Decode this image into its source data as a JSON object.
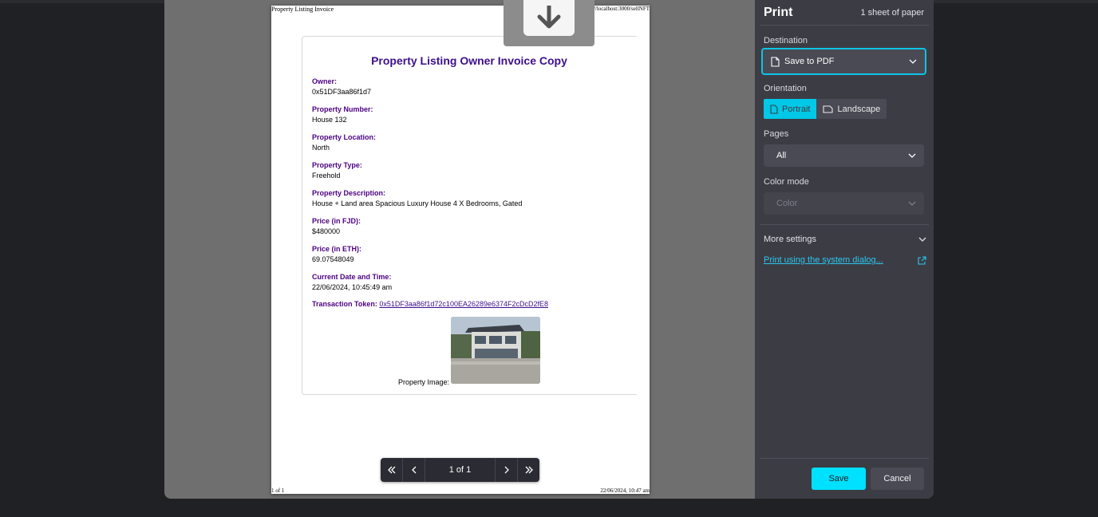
{
  "document": {
    "header_left": "Property Listing Invoice",
    "header_right": "http://localhost:3000/sellNFT",
    "footer_left": "1 of 1",
    "footer_right": "22/06/2024, 10:47 am",
    "title": "Property Listing Owner Invoice Copy",
    "fields": [
      {
        "label": "Owner:",
        "value": "0x51DF3aa86f1d7"
      },
      {
        "label": "Property Number:",
        "value": "House 132"
      },
      {
        "label": "Property Location:",
        "value": "North"
      },
      {
        "label": "Property Type:",
        "value": "Freehold"
      },
      {
        "label": "Property Description:",
        "value": "House + Land area Spacious Luxury House 4 X Bedrooms, Gated"
      },
      {
        "label": "Price (in FJD):",
        "value": "$480000"
      },
      {
        "label": "Price (in ETH):",
        "value": "69.07548049"
      },
      {
        "label": "Current Date and Time:",
        "value": "22/06/2024, 10:45:49 am"
      }
    ],
    "token_label": "Transaction Token:",
    "token_value": "0x51DF3aa86f1d72c100EA26289e6374F2cDcD2fE8",
    "image_label": "Property Image:"
  },
  "pager": {
    "page_count": "1 of 1"
  },
  "panel": {
    "title": "Print",
    "sheets": "1 sheet of paper",
    "destination_label": "Destination",
    "destination_value": "Save to PDF",
    "orientation_label": "Orientation",
    "portrait_label": "Portrait",
    "landscape_label": "Landscape",
    "orientation_selected": "Portrait",
    "pages_label": "Pages",
    "pages_value": "All",
    "color_label": "Color mode",
    "color_value": "Color",
    "more_settings": "More settings",
    "system_dialog_link": "Print using the system dialog...",
    "save_button": "Save",
    "cancel_button": "Cancel",
    "accent_color": "#00e0ff"
  }
}
